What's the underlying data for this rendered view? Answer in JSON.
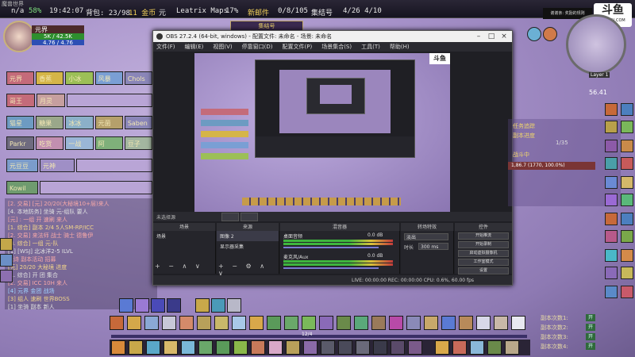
{
  "top_bar": {
    "window_title": "魔兽世界",
    "items": [
      "n/a",
      "58%",
      "19:42:07",
      "背包: 23/98",
      "11 金币",
      "元",
      "Leatrix Maps",
      "17%",
      "新邮件",
      "0/8/105",
      "集结号",
      "4/26 4/10"
    ]
  },
  "player": {
    "name": "元界",
    "hp": "5K / 42.5K",
    "mp": "4.76 / 4.76"
  },
  "raid_frames": [
    [
      "元界",
      "香蕉",
      "小冰",
      "风暴",
      "Chols"
    ],
    [
      "哥王",
      "月灵"
    ],
    [
      "猫星",
      "糖果",
      "冰冰",
      "元菌",
      "Saben"
    ],
    [
      "Parkr",
      "吃货",
      "一战",
      "阿",
      "豆子"
    ],
    [
      "元豆豆",
      "元神"
    ],
    [
      "Kowil"
    ]
  ],
  "chat_lines": [
    "[2. 交易] [元] 20/20(大秘境10+层)来人",
    "[4. 本地防务] 坐骑 元-组队 要人",
    "[元] : 一组 开 速刷 来人",
    "[1. 综合] 副本 2/4 5人SM-RP/ICC",
    "[2. 交易] 来法师 战士 骑士 德鲁伊",
    "[3. 综合] 一组 元-队",
    "[1] [WSJ] 北冰洋2-5 ILVL",
    "元诗 副本活动 招募",
    "[元] 20/20 大秘境 进度",
    "[1. 综合] 开 团 集合",
    "[2. 交易] ICC 10H 来人",
    "[4] 元界 金团 战场",
    "[3] 组人 速刷 世界BOSS",
    "[1] 坐骑 副本 新人"
  ],
  "obs": {
    "title": "OBS 27.2.4 (64-bit, windows) - 配置文件: 未命名 - 场景: 未命名",
    "menu": [
      "文件(F)",
      "编辑(E)",
      "视图(V)",
      "停靠窗口(D)",
      "配置文件(P)",
      "场景集合(S)",
      "工具(T)",
      "帮助(H)"
    ],
    "docks": [
      "场景",
      "来源",
      "混音器",
      "转场特效",
      "控件"
    ],
    "scenes": [
      "场景"
    ],
    "sources": [
      "图像 2",
      "显示器采集"
    ],
    "mixer": [
      {
        "name": "桌面音频",
        "level": "0.0 dB"
      },
      {
        "name": "麦克风/Aux",
        "level": "0.0 dB"
      }
    ],
    "transition": {
      "type": "淡出",
      "duration_label": "时长",
      "duration": "300 ms"
    },
    "controls": [
      "开始推流",
      "开始录制",
      "启动虚拟摄像机",
      "工作室模式",
      "设置",
      "退出"
    ],
    "status": "LIVE: 00:00:00   REC: 00:00:00   CPU: 0.6%, 60.00 fps",
    "preview_label": "未选择源"
  },
  "right": {
    "douyu": "斗鱼",
    "douyu_sub": "DOUYU.COM",
    "stream_note": "谢谢亲: 奖励的规则",
    "minimap_label": "Layer 1",
    "coords": "56.41"
  },
  "quest": {
    "lines": [
      "任务追踪",
      "副本进度",
      "1/35",
      "战斗中"
    ],
    "value": "1,86.7 (1770, 100.0%)"
  },
  "dungeons": [
    {
      "label": "副本次数1:",
      "btn": "开"
    },
    {
      "label": "副本次数2:",
      "btn": "开"
    },
    {
      "label": "副本次数3:",
      "btn": "开"
    },
    {
      "label": "副本次数4:",
      "btn": "开"
    }
  ],
  "action_bar_footer": "12/4"
}
